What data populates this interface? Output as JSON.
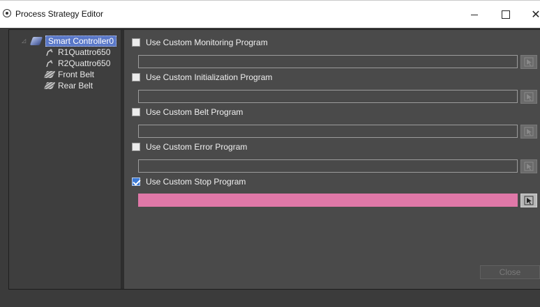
{
  "window": {
    "title": "Process Strategy Editor",
    "controls": {
      "minimize_icon": "minimize-icon",
      "maximize_icon": "maximize-icon",
      "close_symbol": "✕"
    }
  },
  "tree": {
    "items": [
      {
        "label": "Smart Controller0",
        "icon": "controller-icon",
        "selected": true
      },
      {
        "label": "R1Quattro650",
        "icon": "robot-icon"
      },
      {
        "label": "R2Quattro650",
        "icon": "robot-icon"
      },
      {
        "label": "Front Belt",
        "icon": "belt-icon"
      },
      {
        "label": "Rear Belt",
        "icon": "belt-icon"
      }
    ]
  },
  "programs": [
    {
      "label": "Use Custom Monitoring Program",
      "checked": false,
      "value": ""
    },
    {
      "label": "Use Custom Initialization Program",
      "checked": false,
      "value": ""
    },
    {
      "label": "Use Custom Belt Program",
      "checked": false,
      "value": ""
    },
    {
      "label": "Use Custom Error Program",
      "checked": false,
      "value": ""
    },
    {
      "label": "Use Custom Stop Program",
      "checked": true,
      "value": ""
    }
  ],
  "footer": {
    "close_label": "Close"
  },
  "colors": {
    "highlight_field": "#e078a8",
    "selection": "#5a78c8",
    "checkbox_checked": "#3c7ad6"
  }
}
